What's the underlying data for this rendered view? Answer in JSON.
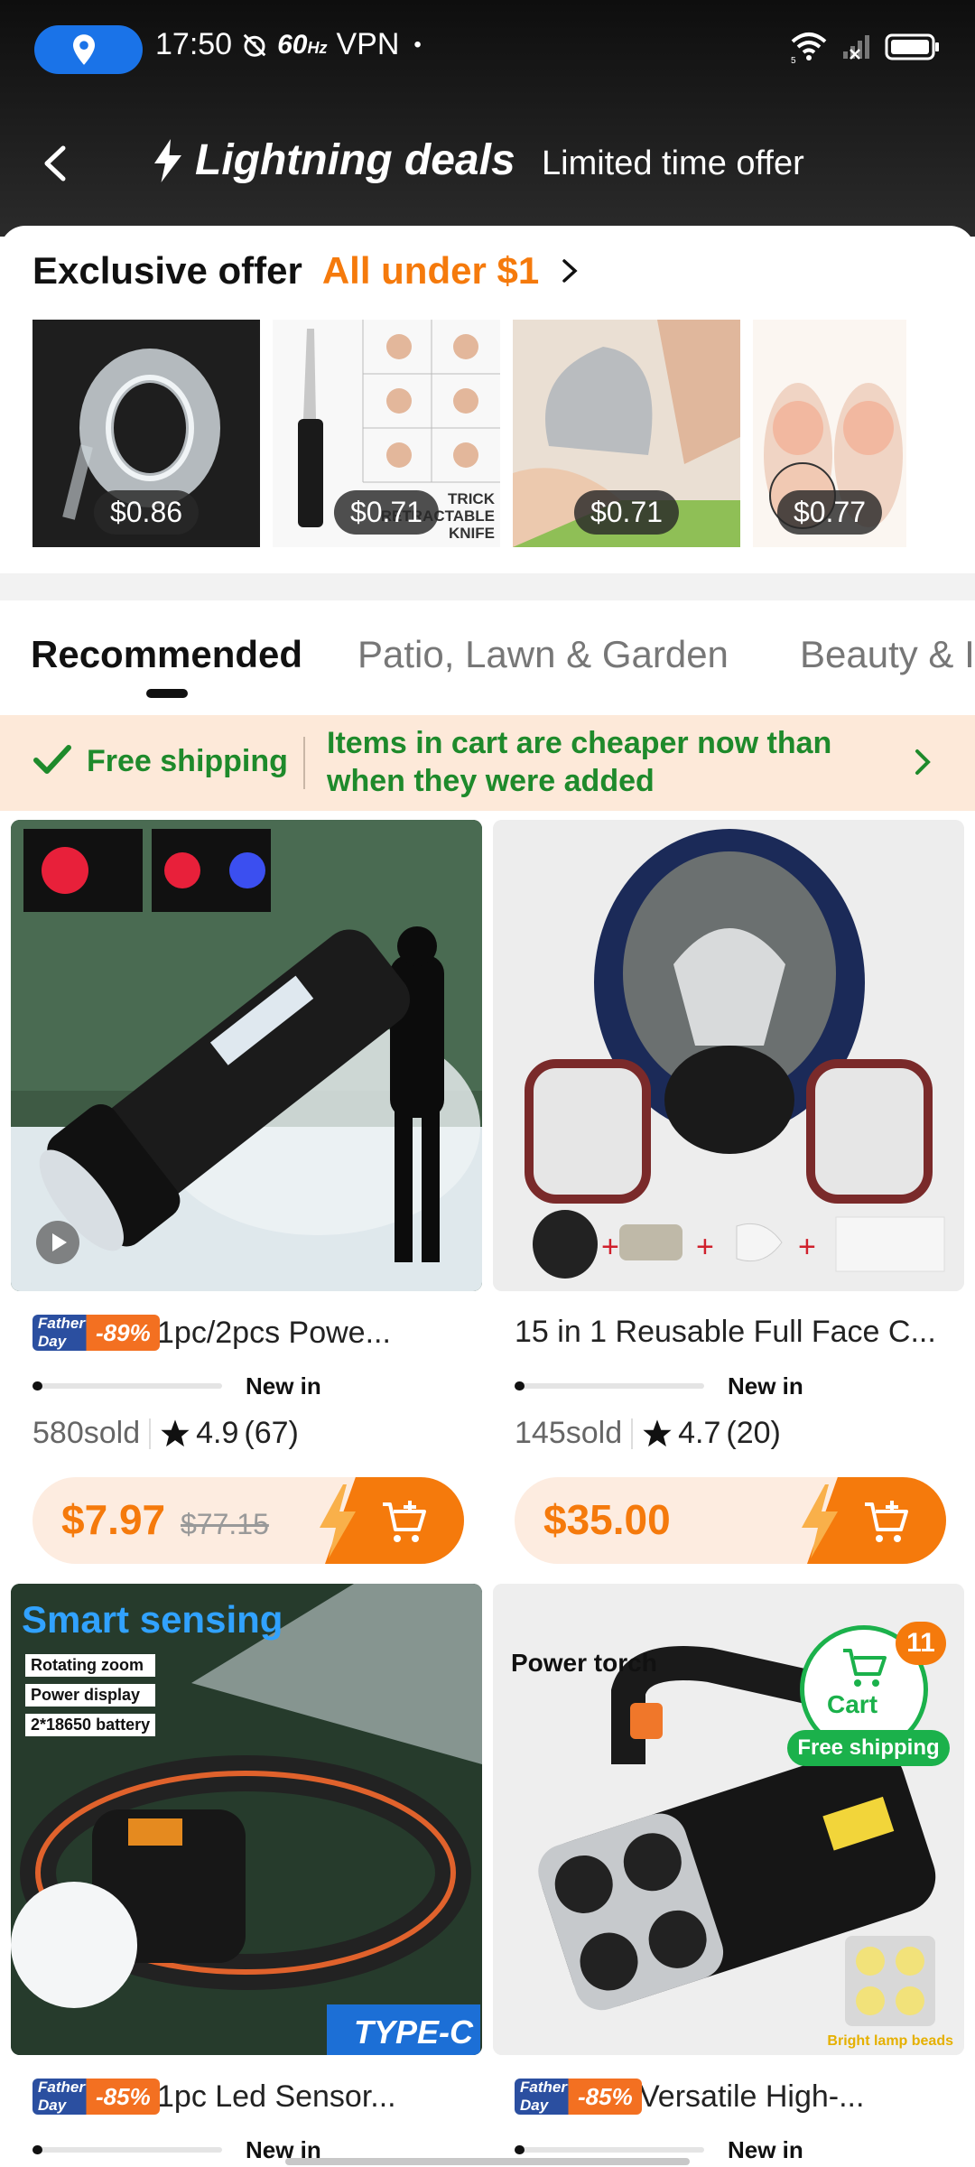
{
  "status_bar": {
    "time": "17:50",
    "refresh": "60",
    "refresh_unit": "Hz",
    "vpn": "VPN",
    "dot": "•",
    "wifi_gen": "5"
  },
  "header": {
    "title": "Lightning deals",
    "subtitle": "Limited time offer"
  },
  "exclusive": {
    "label": "Exclusive offer",
    "highlight": "All under $1",
    "items": [
      {
        "price": "$0.86",
        "overlay": ""
      },
      {
        "price": "$0.71",
        "overlay": "TRICK\nRETRACTABLE\nKNIFE"
      },
      {
        "price": "$0.71",
        "overlay": ""
      },
      {
        "price": "$0.77",
        "overlay": ""
      }
    ]
  },
  "tabs": [
    {
      "label": "Recommended"
    },
    {
      "label": "Patio, Lawn & Garden"
    },
    {
      "label": "Beauty & I"
    }
  ],
  "banner": {
    "free": "Free shipping",
    "message": "Items in cart are cheaper now than when they were added"
  },
  "products": [
    {
      "badge": "Father's Day",
      "discount": "-89%",
      "title": "1pc/2pcs Powe...",
      "newin": "New in",
      "progress": 0.05,
      "sold": "580",
      "sold_word": "sold",
      "rating": "4.9",
      "reviews": "(67)",
      "price": "$7.97",
      "old_price": "$77.15"
    },
    {
      "badge": "",
      "discount": "",
      "title": "15 in 1 Reusable Full Face C...",
      "newin": "New in",
      "progress": 0.05,
      "sold": "145",
      "sold_word": "sold",
      "rating": "4.7",
      "reviews": "(20)",
      "price": "$35.00",
      "old_price": ""
    },
    {
      "badge": "Father's Day",
      "discount": "-85%",
      "title": "1pc Led Sensor...",
      "newin": "New in",
      "progress": 0.05,
      "image_text": {
        "headline": "Smart sensing",
        "tags": [
          "Rotating zoom",
          "Power display",
          "2*18650 battery"
        ],
        "corner": "TYPE-C"
      }
    },
    {
      "badge": "Father's Day",
      "discount": "-85%",
      "title": "Versatile High-...",
      "newin": "New in",
      "progress": 0.05,
      "image_text": {
        "headline": "Power torch",
        "note": "Bright lamp beads"
      }
    }
  ],
  "floating_cart": {
    "count": "11",
    "label": "Cart",
    "free": "Free shipping"
  },
  "colors": {
    "accent": "#f57a0c",
    "green": "#1bb14b",
    "banner_bg": "#fde9d9",
    "header_bg": "#1a1a1a"
  }
}
